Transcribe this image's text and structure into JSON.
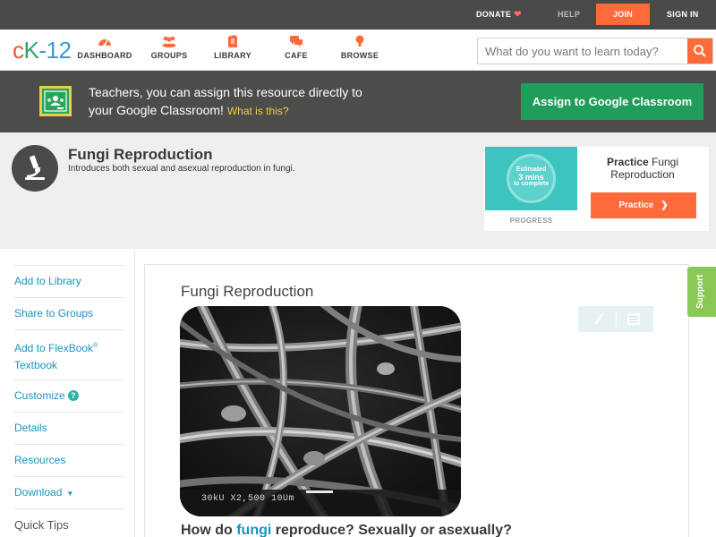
{
  "topbar": {
    "donate": "DONATE",
    "help": "HELP",
    "join": "JOIN",
    "signin": "SIGN IN"
  },
  "nav": {
    "logo_parts": [
      "c",
      "K",
      "-12"
    ],
    "items": [
      {
        "label": "DASHBOARD",
        "icon": "dashboard-icon"
      },
      {
        "label": "GROUPS",
        "icon": "groups-icon"
      },
      {
        "label": "LIBRARY",
        "icon": "library-icon"
      },
      {
        "label": "CAFE",
        "icon": "cafe-icon"
      },
      {
        "label": "BROWSE",
        "icon": "browse-icon"
      }
    ],
    "search_placeholder": "What do you want to learn today?"
  },
  "banner": {
    "line1": "Teachers, you can assign this resource directly to",
    "line2": "your Google Classroom!",
    "link": "What is this?",
    "button": "Assign to Google Classroom"
  },
  "header": {
    "title": "Fungi Reproduction",
    "subtitle": "Introduces both sexual and asexual reproduction in fungi."
  },
  "practice": {
    "est_line1": "Estimated",
    "est_line2": "3 mins",
    "est_line3": "to complete",
    "progress": "PROGRESS",
    "title_bold": "Practice",
    "title_rest": " Fungi Reproduction",
    "button": "Practice"
  },
  "sidebar": {
    "items": [
      {
        "label": "Add to Library"
      },
      {
        "label": "Share to Groups"
      },
      {
        "label": "Add to FlexBook",
        "sup": "®",
        "label2": "Textbook"
      },
      {
        "label": "Customize",
        "badge": "?"
      },
      {
        "label": "Details"
      },
      {
        "label": "Resources"
      },
      {
        "label": "Download",
        "caret": "▼"
      },
      {
        "label": "Quick Tips"
      }
    ]
  },
  "content": {
    "title": "Fungi Reproduction",
    "image_caption": "30kU  X2,500   10Um",
    "question_pre": "How do ",
    "question_link": "fungi",
    "question_post": " reproduce? Sexually or asexually?"
  },
  "support": "Support",
  "colors": {
    "accent_orange": "#ff6a3a",
    "google_green": "#1f9d5a",
    "link_blue": "#1b93bd",
    "support_green": "#8ac856"
  }
}
